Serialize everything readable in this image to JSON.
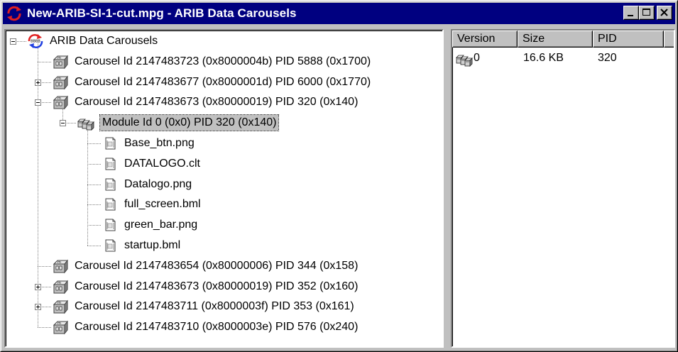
{
  "window": {
    "title": "New-ARIB-SI-1-cut.mpg - ARIB Data Carousels",
    "controls": {
      "minimize_icon": "minimize-icon",
      "maximize_icon": "maximize-icon",
      "close_icon": "close-icon"
    }
  },
  "tree": {
    "root": {
      "label": "ARIB Data Carousels",
      "icon": "carousel-root-icon"
    },
    "carousels": [
      {
        "label": "Carousel Id 2147483723 (0x8000004b) PID 5888 (0x1700)",
        "state": "leaf"
      },
      {
        "label": "Carousel Id 2147483677 (0x8000001d) PID 6000 (0x1770)",
        "state": "collapsed"
      },
      {
        "label": "Carousel Id 2147483673 (0x80000019) PID 320 (0x140)",
        "state": "expanded"
      },
      {
        "label": "Carousel Id 2147483654 (0x80000006) PID 344 (0x158)",
        "state": "leaf"
      },
      {
        "label": "Carousel Id 2147483673 (0x80000019) PID 352 (0x160)",
        "state": "collapsed"
      },
      {
        "label": "Carousel Id 2147483711 (0x8000003f) PID 353 (0x161)",
        "state": "collapsed"
      },
      {
        "label": "Carousel Id 2147483710 (0x8000003e) PID 576 (0x240)",
        "state": "leaf"
      }
    ],
    "module": {
      "label": "Module Id 0 (0x0) PID 320 (0x140)",
      "selected": true
    },
    "files": [
      "Base_btn.png",
      "DATALOGO.clt",
      "Datalogo.png",
      "full_screen.bml",
      "green_bar.png",
      "startup.bml"
    ]
  },
  "list": {
    "columns": [
      "Version",
      "Size",
      "PID"
    ],
    "rows": [
      {
        "version": "0",
        "size": "16.6 KB",
        "pid": "320"
      }
    ]
  },
  "colors": {
    "title_bar": "#000080",
    "face": "#c0c0c0",
    "window_bg": "#ffffff"
  }
}
